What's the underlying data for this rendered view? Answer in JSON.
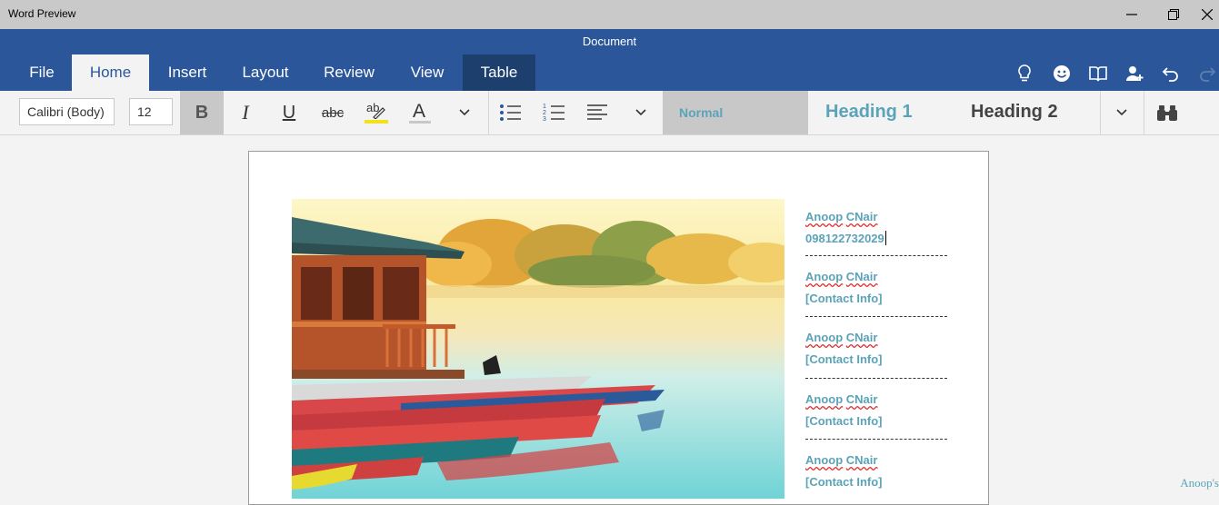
{
  "window": {
    "app_title": "Word Preview",
    "doc_title": "Document"
  },
  "ribbon": {
    "tabs": [
      "File",
      "Home",
      "Insert",
      "Layout",
      "Review",
      "View",
      "Table"
    ],
    "active_tab": "Home"
  },
  "toolbar": {
    "font_name": "Calibri (Body)",
    "font_size": "12",
    "bold_label": "B",
    "italic_label": "I",
    "underline_label": "U",
    "strike_label": "abc",
    "highlight_label": "ab",
    "font_color_label": "A",
    "styles": {
      "normal": "Normal",
      "heading1": "Heading 1",
      "heading2": "Heading 2"
    }
  },
  "document": {
    "entries": [
      {
        "name_parts": [
          "Anoop",
          "CNair"
        ],
        "info": "098122732029"
      },
      {
        "name_parts": [
          "Anoop",
          "CNair"
        ],
        "info": "[Contact Info]"
      },
      {
        "name_parts": [
          "Anoop",
          "CNair"
        ],
        "info": "[Contact Info]"
      },
      {
        "name_parts": [
          "Anoop",
          "CNair"
        ],
        "info": "[Contact Info]"
      },
      {
        "name_parts": [
          "Anoop",
          "CNair"
        ],
        "info": "[Contact Info]"
      }
    ]
  },
  "watermark": "Anoop's",
  "colors": {
    "ribbon": "#2b579a",
    "accent_text": "#5ba3b8",
    "table_tab": "#1d3f6e"
  }
}
